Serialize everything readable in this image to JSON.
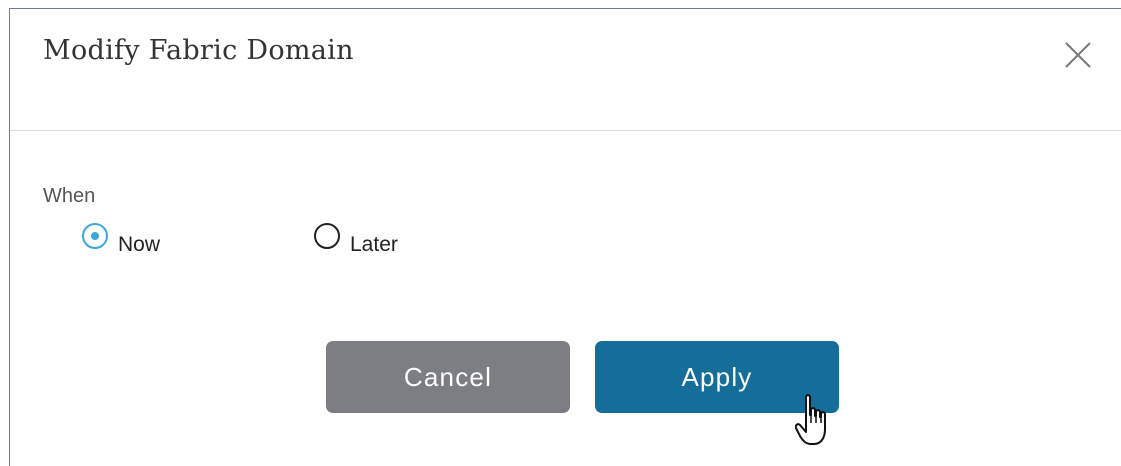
{
  "dialog": {
    "title": "Modify Fabric Domain",
    "close_icon": "close-icon",
    "when_label": "When",
    "options": [
      {
        "label": "Now",
        "selected": true
      },
      {
        "label": "Later",
        "selected": false
      }
    ],
    "cancel_label": "Cancel",
    "apply_label": "Apply"
  },
  "colors": {
    "apply_button": "#156e99",
    "cancel_button": "#7c7e83",
    "radio_accent": "#3aa9dc"
  },
  "pointer": {
    "icon": "hand-pointer-icon"
  }
}
